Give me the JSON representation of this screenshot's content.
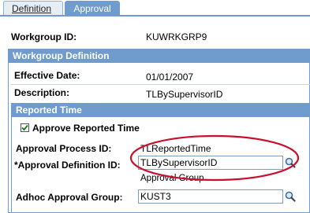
{
  "tabs": [
    {
      "label": "Definition",
      "active": false
    },
    {
      "label": "Approval",
      "active": true
    }
  ],
  "workgroup": {
    "id_label": "Workgroup ID:",
    "id_value": "KUWRKGRP9"
  },
  "workgroup_definition": {
    "header": "Workgroup Definition",
    "effective_date_label": "Effective Date:",
    "effective_date_value": "01/01/2007",
    "description_label": "Description:",
    "description_value": "TLBySupervisorID"
  },
  "reported_time": {
    "header": "Reported Time",
    "approve_checkbox_label": "Approve Reported Time",
    "approve_checked": true,
    "approval_process_label": "Approval Process ID:",
    "approval_process_value": "TLReportedTime",
    "approval_definition_label": "*Approval Definition ID:",
    "approval_definition_value": "TLBySupervisorID",
    "approval_group_caption": "Approval Group",
    "adhoc_group_label": "Adhoc Approval Group:",
    "adhoc_group_value": "KUST3"
  },
  "colors": {
    "header_blue": "#6f9ccc",
    "highlight_oval": "#c8102e"
  },
  "icons": {
    "lookup": "magnifier-icon",
    "checkbox": "checkmark-icon"
  }
}
